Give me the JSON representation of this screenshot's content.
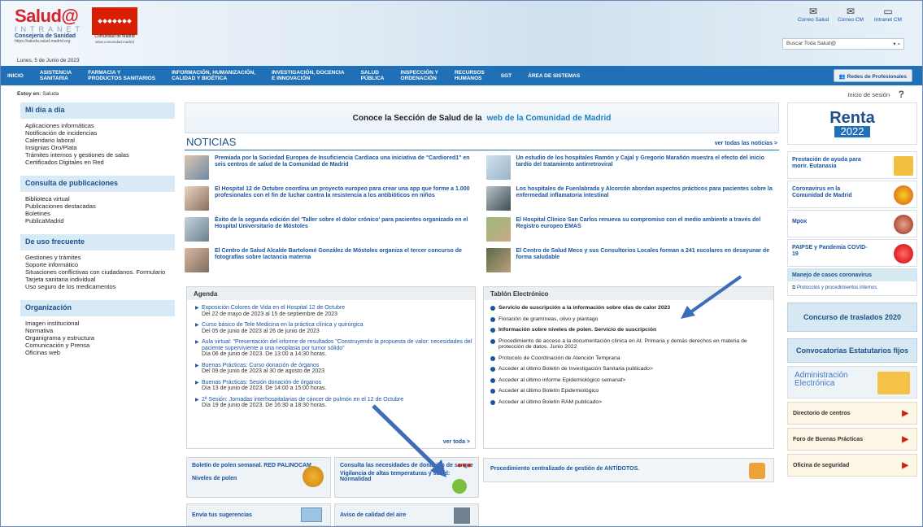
{
  "header": {
    "logo_title": "Salud@",
    "logo_intranet": "INTRANET",
    "logo_consejeria": "Consejería de Sanidad",
    "logo_url": "https://saluda.salud.madrid.org",
    "cm_name": "Comunidad de Madrid",
    "cm_url": "www.comunidad.madrid",
    "date": "Lunes, 5 de Junio de 2023",
    "top_links": [
      {
        "label": "Correo Salud",
        "icon": "mail-icon"
      },
      {
        "label": "Correo CM",
        "icon": "mail-icon"
      },
      {
        "label": "Intranet CM",
        "icon": "monitor-icon"
      }
    ],
    "search_placeholder": "Buscar Toda Salud@"
  },
  "nav": {
    "items": [
      "INICIO",
      "ASISTENCIA\nSANITARIA",
      "FARMACIA Y\nPRODUCTOS SANITARIOS",
      "INFORMACIÓN, HUMANIZACIÓN,\nCALIDAD Y BIOÉTICA",
      "INVESTIGACIÓN, DOCENCIA\nE INNOVACIÓN",
      "SALUD\nPÚBLICA",
      "INSPECCIÓN Y\nORDENACIÓN",
      "RECURSOS\nHUMANOS",
      "SGT",
      "ÁREA DE SISTEMAS"
    ],
    "redes": "Redes de Profesionales"
  },
  "breadcrumb": {
    "prefix": "Estoy en:",
    "current": "Saluda"
  },
  "login": "Inicio de sesión",
  "help": "?",
  "sidebar": {
    "sections": [
      {
        "title": "Mi día a día",
        "items": [
          "Aplicaciones informáticas",
          "Notificación de incidencias",
          "Calendario laboral",
          "Insignias Oro/Plata",
          "Trámites internos y gestiones de salas",
          "Certificados Digitales en Red"
        ]
      },
      {
        "title": "Consulta de publicaciones",
        "items": [
          "Biblioteca virtual",
          "Publicaciones destacadas",
          "Boletines",
          "PublicaMadrid"
        ]
      },
      {
        "title": "De uso frecuente",
        "items": [
          "Gestiones y trámites",
          "Soporte informático",
          "Situaciones conflictivas con ciudadanos. Formulario",
          "Tarjeta sanitaria individual",
          "Uso seguro de los medicamentos"
        ]
      },
      {
        "title": "Organización",
        "items": [
          "Imagen institucional",
          "Normativa",
          "Organigrama y estructura",
          "Comunicación y Prensa",
          "Oficinas web"
        ]
      }
    ]
  },
  "banner": {
    "text": "Conoce la Sección de Salud de la",
    "link": "web de la Comunidad de Madrid"
  },
  "news": {
    "title": "NOTICIAS",
    "all": "ver todas las noticias >",
    "items": [
      "Premiada por la Sociedad Europea de Insuficiencia Cardiaca una iniciativa de \"Cardiored1\" en seis centros de salud de la Comunidad de Madrid",
      "Un estudio de los hospitales Ramón y Cajal y Gregorio Marañón muestra el efecto del inicio tardío del tratamiento antirretroviral",
      "El Hospital 12 de Octubre coordina un proyecto europeo para crear una app que forme a 1.000 profesionales con el fin de luchar contra la resistencia a los antibióticos en niños",
      "Los hospitales de Fuenlabrada y Alcorcón abordan aspectos prácticos para pacientes sobre la enfermedad inflamatoria intestinal",
      "Éxito de la segunda edición del 'Taller sobre el dolor crónico' para pacientes organizado en el Hospital Universitario de Móstoles",
      "El Hospital Clínico San Carlos renueva su compromiso con el medio ambiente a través del Registro europeo EMAS",
      "El Centro de Salud Alcalde Bartolomé González de Móstoles organiza el tercer concurso de fotografías sobre lactancia materna",
      "El Centro de Salud Meco y sus Consultorios Locales forman a 241 escolares en desayunar de forma saludable"
    ]
  },
  "agenda": {
    "title": "Agenda",
    "items": [
      {
        "title": "Exposición Colores de Vida en el Hospital 12 de Octubre",
        "date": "Del 22 de mayo de 2023 al 15 de septiembre de 2023"
      },
      {
        "title": "Curso básico de Tele Medicina en la práctica clínica y quirúrgica",
        "date": "Del 05 de junio de 2023 al 26 de junio de 2023"
      },
      {
        "title": "Aula virtual: \"Presentación del informe de resultados \"Construyendo la propuesta de valor: necesidades del paciente superviviente a una neoplasia por tumor sólido\"",
        "date": "Día 06 de junio de 2023. De 13:00 a 14:30 horas."
      },
      {
        "title": "Buenas Prácticas: Curso donación de órganos",
        "date": "Del 09 de junio de 2023 al 30 de agosto de 2023"
      },
      {
        "title": "Buenas Prácticas: Sesión donación de órganos",
        "date": "Día 13 de junio de 2023. De 14:00 a 15:00 horas."
      },
      {
        "title": "2ª Sesión: Jornadas interhospitalarias de cáncer de pulmón en el 12 de Octubre",
        "date": "Día 19 de junio de 2023. De 16:30 a 18:30 horas."
      }
    ],
    "more": "ver toda >"
  },
  "tablon": {
    "title": "Tablón Electrónico",
    "items": [
      "Servicio de suscripción a la información sobre olas de calor 2023",
      "Floración de gramíneas, olivo y plantago",
      "Información sobre niveles de polen. Servicio de suscripción",
      "Procedimiento de acceso a la documentación clínica en At. Primaria y demás derechos en materia de protección de datos. Junio 2022",
      "Protocolo de Coordinación de Atención Temprana",
      "Acceder al último Boletín de Investigación Sanitaria publicado>",
      "Acceder al último informe Epidemiológico semanal>",
      "Acceder al último Boletín Epidemiológico",
      "Acceder al último Boletín RAM publicado>"
    ],
    "antidotos": "Procedimiento centralizado de gestión de ANTÍDOTOS."
  },
  "mini": {
    "polen_title": "Boletín de polen semanal. RED PALINOCAM",
    "polen_link": "Niveles de polen",
    "sangre_title": "Consulta las necesidades de donación de sangre",
    "vigilancia": "Vigilancia de altas temperaturas y salud: Normalidad",
    "sugerencias": "Envía tus sugerencias",
    "aire": "Aviso de calidad del aire"
  },
  "right": {
    "renta": "Renta",
    "renta_year": "2022",
    "items": [
      "Prestación de ayuda para morir. Eutanasia",
      "Coronavirus en la Comunidad de Madrid",
      "Mpox",
      "PAIPSE y Pandemia COVID-19"
    ],
    "covid_head": "Manejo de casos coronavirus",
    "covid_link": "Protocolos y procedimientos internos",
    "traslados": "Concurso de traslados 2020",
    "estatutarios": "Convocatorias Estatutarios fijos",
    "admin": "Administración Electrónica",
    "links": [
      "Directorio de centros",
      "Foro de Buenas Prácticas",
      "Oficina de seguridad"
    ]
  }
}
